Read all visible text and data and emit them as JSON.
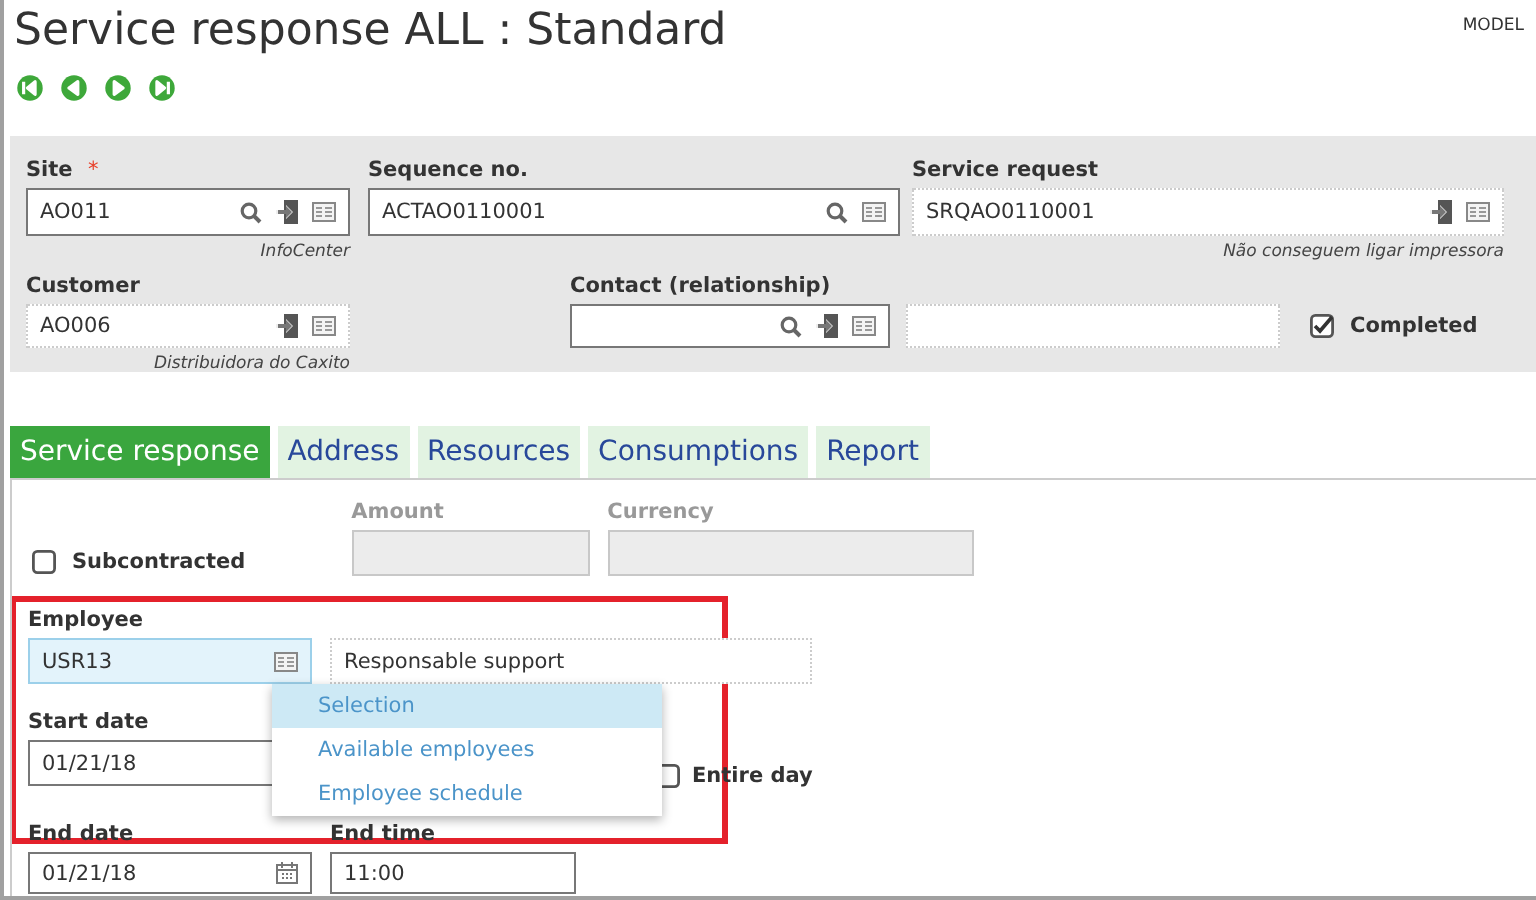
{
  "window": {
    "title": "Service response ALL : Standard",
    "mode": "MODEL"
  },
  "nav_buttons": [
    {
      "kind": "first"
    },
    {
      "kind": "previous"
    },
    {
      "kind": "next"
    },
    {
      "kind": "last"
    }
  ],
  "header_fields": [
    {
      "label": "Site",
      "required_mark": "*",
      "value": "AO011",
      "icons": [
        {
          "kind": "search"
        },
        {
          "kind": "jump"
        },
        {
          "kind": "detail"
        }
      ],
      "hint": "InfoCenter"
    },
    {
      "label": "Sequence no.",
      "value": "ACTAO0110001",
      "icons": [
        {
          "kind": "search"
        },
        {
          "kind": "detail"
        }
      ]
    },
    {
      "label": "Service request",
      "value": "SRQAO0110001",
      "icons": [
        {
          "kind": "jump"
        },
        {
          "kind": "detail"
        }
      ],
      "hint": "Não conseguem ligar impressora"
    },
    {
      "label": "Customer",
      "value": "AO006",
      "icons": [
        {
          "kind": "jump"
        },
        {
          "kind": "detail"
        }
      ],
      "hint": "Distribuidora do Caxito"
    },
    {
      "label": "Contact (relationship)",
      "icons": [
        {
          "kind": "search"
        },
        {
          "kind": "jump"
        },
        {
          "kind": "detail"
        }
      ]
    }
  ],
  "completed": {
    "label": "Completed",
    "checked": true
  },
  "tabs": [
    {
      "label": "Service response",
      "selected": true
    },
    {
      "label": "Address",
      "selected": false
    },
    {
      "label": "Resources",
      "selected": false
    },
    {
      "label": "Consumptions",
      "selected": false
    },
    {
      "label": "Report",
      "selected": false
    }
  ],
  "subcontracted": {
    "label": "Subcontracted",
    "checked": false
  },
  "amount": {
    "label": "Amount",
    "disabled": true
  },
  "currency": {
    "label": "Currency",
    "disabled": true
  },
  "employee": {
    "label": "Employee",
    "value": "USR13",
    "focused": true,
    "description": "Responsable support"
  },
  "start_date": {
    "label": "Start date",
    "value": "01/21/18"
  },
  "entire_day": {
    "label": "Entire day",
    "checked": false
  },
  "end_date": {
    "label": "End date",
    "value": "01/21/18"
  },
  "end_time": {
    "label": "End time",
    "value": "11:00"
  },
  "context_menu": [
    {
      "label": "Selection",
      "selected": true
    },
    {
      "label": "Available employees",
      "selected": false
    },
    {
      "label": "Employee schedule",
      "selected": false
    }
  ]
}
